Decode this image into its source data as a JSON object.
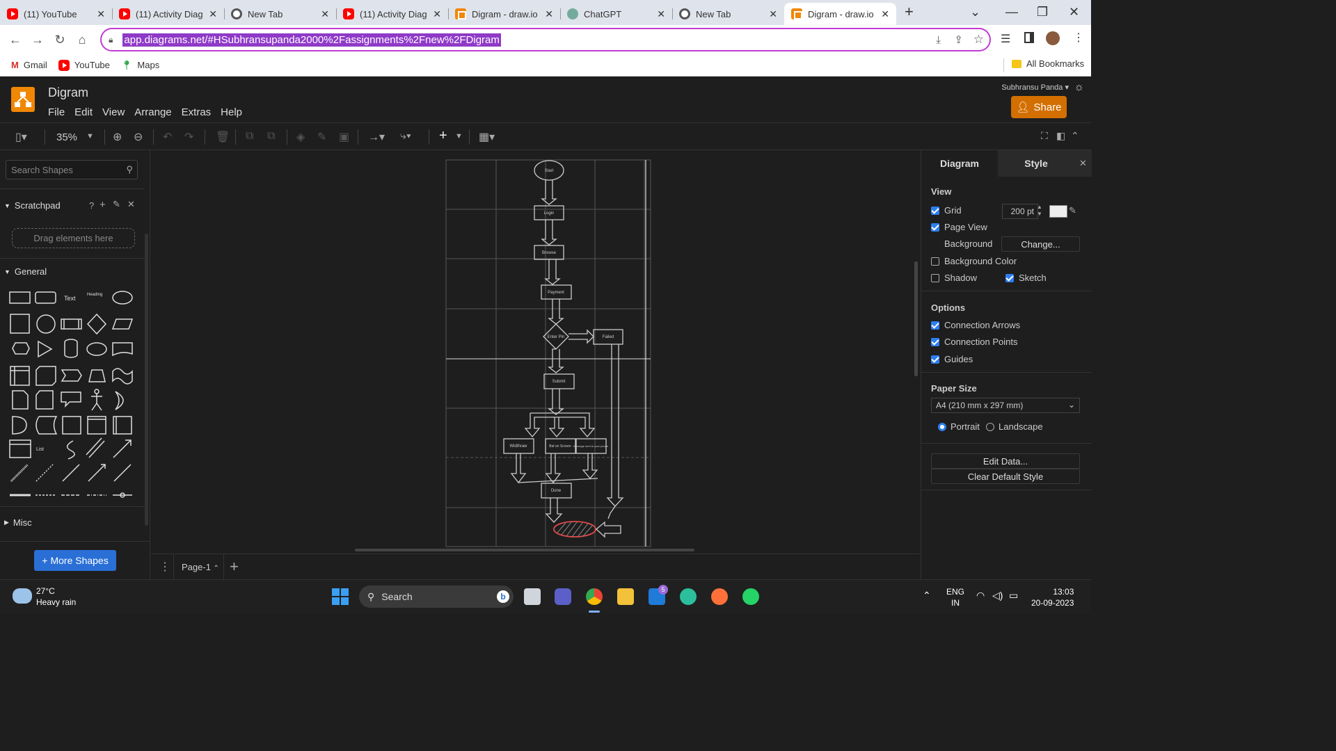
{
  "browser": {
    "tabs": [
      {
        "title": "(11) YouTube",
        "icon": "youtube-icon"
      },
      {
        "title": "(11) Activity Diagr",
        "icon": "youtube-icon"
      },
      {
        "title": "New Tab",
        "icon": "chrome-icon"
      },
      {
        "title": "(11) Activity Diagr",
        "icon": "youtube-icon"
      },
      {
        "title": "Digram - draw.io",
        "icon": "drawio-icon"
      },
      {
        "title": "ChatGPT",
        "icon": "chatgpt-icon"
      },
      {
        "title": "New Tab",
        "icon": "chrome-icon"
      },
      {
        "title": "Digram - draw.io",
        "icon": "drawio-icon",
        "active": true
      }
    ],
    "url": "app.diagrams.net/#HSubhransupanda2000%2Fassignments%2Fnew%2FDigram",
    "bookmarks": [
      "Gmail",
      "YouTube",
      "Maps"
    ],
    "all_bookmarks": "All Bookmarks"
  },
  "app": {
    "doc_title": "Digram",
    "menu": [
      "File",
      "Edit",
      "View",
      "Arrange",
      "Extras",
      "Help"
    ],
    "user_name": "Subhransu Panda",
    "share_label": "Share",
    "zoom": "35%"
  },
  "left_panel": {
    "search_placeholder": "Search Shapes",
    "scratchpad_title": "Scratchpad",
    "scratchpad_help": "?",
    "drag_hint": "Drag elements here",
    "general_title": "General",
    "shape_text_label": "Text",
    "shape_heading_label": "Heading",
    "shape_list_label": "List",
    "misc_title": "Misc",
    "more_shapes_label": "More Shapes"
  },
  "diagram": {
    "nodes": [
      "Start",
      "Login",
      "Browse",
      "Payment",
      "Enter Pin",
      "Failed",
      "Submit",
      "Widthraw",
      "Bal on Screen",
      "Message sent to your phone",
      "Done"
    ]
  },
  "page_bar": {
    "page_name": "Page-1"
  },
  "right_panel": {
    "tab_diagram": "Diagram",
    "tab_style": "Style",
    "view_title": "View",
    "grid_label": "Grid",
    "grid_size": "200 pt",
    "page_view_label": "Page View",
    "background_label": "Background",
    "change_label": "Change...",
    "bg_color_label": "Background Color",
    "shadow_label": "Shadow",
    "sketch_label": "Sketch",
    "options_title": "Options",
    "conn_arrows_label": "Connection Arrows",
    "conn_points_label": "Connection Points",
    "guides_label": "Guides",
    "paper_size_title": "Paper Size",
    "paper_size_value": "A4 (210 mm x 297 mm)",
    "portrait_label": "Portrait",
    "landscape_label": "Landscape",
    "edit_data_label": "Edit Data...",
    "clear_style_label": "Clear Default Style",
    "checks": {
      "grid": true,
      "page_view": true,
      "bg_color": false,
      "shadow": false,
      "sketch": true,
      "conn_arrows": true,
      "conn_points": true,
      "guides": true
    },
    "orientation": "Portrait"
  },
  "taskbar": {
    "weather_temp": "27°C",
    "weather_desc": "Heavy rain",
    "search_label": "Search",
    "lang_line1": "ENG",
    "lang_line2": "IN",
    "time": "13:03",
    "date": "20-09-2023",
    "mail_badge": "5"
  },
  "colors": {
    "accent_share": "#d36f00",
    "drawio_orange": "#f08705",
    "checkbox_blue": "#2d7ff0",
    "more_shapes_blue": "#2a6fd6",
    "omnibox_border": "#c239d6",
    "end_node_red": "#e24a4a"
  }
}
